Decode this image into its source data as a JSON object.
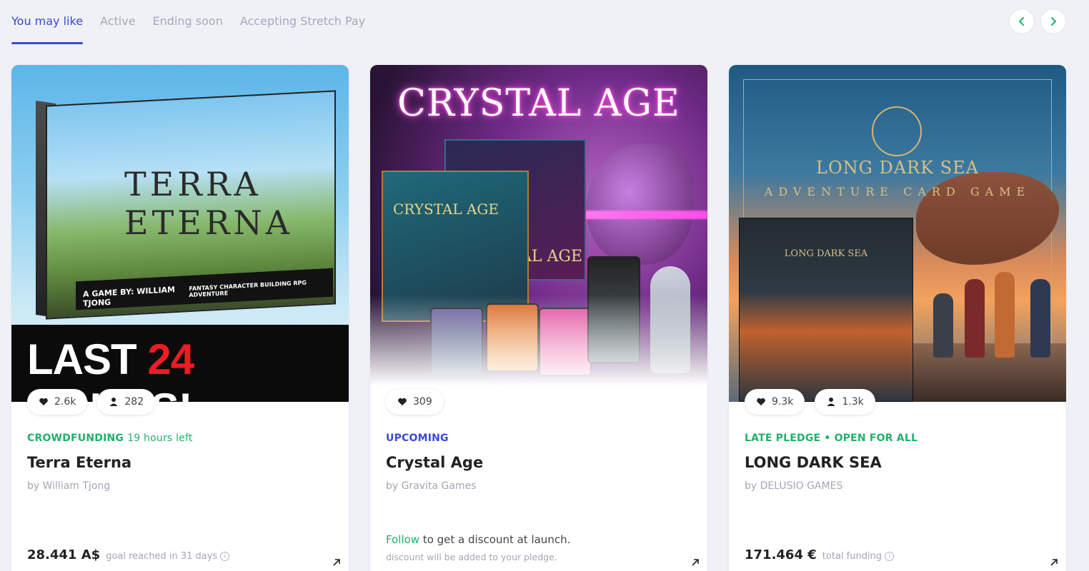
{
  "tabs": [
    {
      "label": "You may like",
      "active": true
    },
    {
      "label": "Active",
      "active": false
    },
    {
      "label": "Ending soon",
      "active": false
    },
    {
      "label": "Accepting Stretch Pay",
      "active": false
    }
  ],
  "nav": {
    "prev_icon": "chevron-left-icon",
    "next_icon": "chevron-right-icon",
    "color": "#1fb16a"
  },
  "colors": {
    "accent": "#3a49d8",
    "green": "#1fb16a",
    "upcoming": "#3a49d8"
  },
  "cards": [
    {
      "image": {
        "logo": "TERRA ETERNA",
        "band_left": "A GAME BY: WILLIAM TJONG",
        "band_right": "FANTASY CHARACTER BUILDING RPG ADVENTURE",
        "banner_pre": "LAST ",
        "banner_num": "24",
        "banner_post": " HOURS!"
      },
      "likes": "2.6k",
      "backers": "282",
      "status": "CROWDFUNDING",
      "status_extra": "19 hours left",
      "title": "Terra Eterna",
      "by": "by William Tjong",
      "amount": "28.441 A$",
      "amount_label": "goal reached in 31 days"
    },
    {
      "image": {
        "logo": "CRYSTAL AGE",
        "box_front": "CRYSTAL AGE",
        "box_back": "AL AGE"
      },
      "likes": "309",
      "status": "UPCOMING",
      "title": "Crystal Age",
      "by": "by Gravita Games",
      "follow_link": "Follow",
      "follow_text": " to get a discount at launch.",
      "follow_sub": "discount will be added to your pledge."
    },
    {
      "image": {
        "logo": "LONG DARK SEA",
        "subtitle": "ADVENTURE CARD GAME",
        "box_label": "LONG DARK SEA"
      },
      "likes": "9.3k",
      "backers": "1.3k",
      "status": "LATE PLEDGE • OPEN FOR ALL",
      "title": "LONG DARK SEA",
      "by": "by DELUSIO GAMES",
      "amount": "171.464 €",
      "amount_label": "total funding"
    }
  ]
}
